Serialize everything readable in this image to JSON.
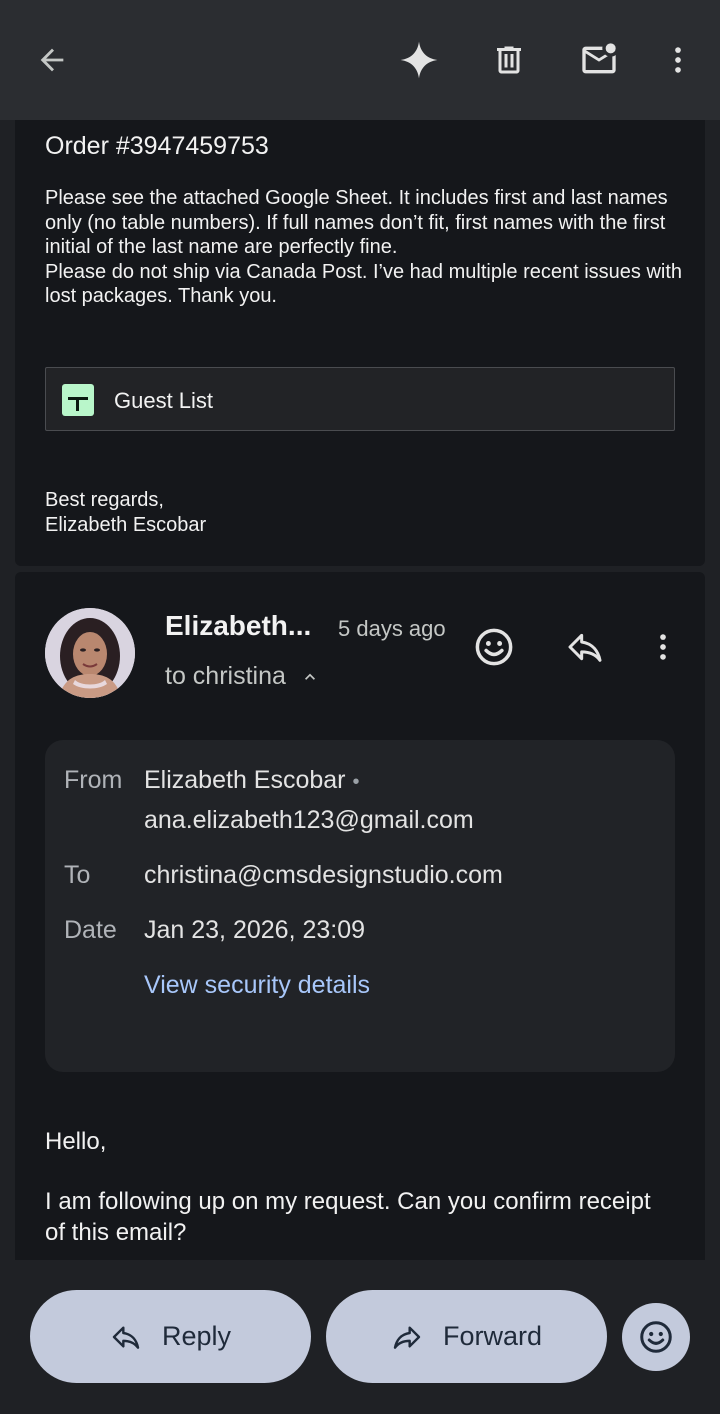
{
  "topbar": {
    "back_icon": "arrow-left-icon",
    "gemini_icon": "sparkle-icon",
    "delete_icon": "trash-icon",
    "mark_unread_icon": "mail-unread-icon",
    "more_icon": "more-vertical-icon"
  },
  "previous_message": {
    "order": "Order #3947459753",
    "body_lines": [
      "Please see the attached Google Sheet. It includes first and last names only (no table numbers). If full names don’t fit, first names with the first initial of the last name are perfectly fine.",
      "Please do not ship via Canada Post. I’ve had multiple recent issues with lost packages. Thank you."
    ],
    "attachment": {
      "label": "Guest List",
      "icon": "google-sheets-icon"
    },
    "closing": "Best regards,",
    "signature": "Elizabeth Escobar"
  },
  "message": {
    "sender_short": "Elizabeth...",
    "time_ago": "5 days ago",
    "to_line": "to christina",
    "details": {
      "from_label": "From",
      "from_name": "Elizabeth Escobar",
      "from_dot": "•",
      "from_email": "ana.elizabeth123@gmail.com",
      "to_label": "To",
      "to_value": "christina@cmsdesignstudio.com",
      "date_label": "Date",
      "date_value": "Jan 23, 2026, 23:09",
      "security_link": "View security details"
    },
    "greeting": "Hello,",
    "body": "I am following up on my request. Can you confirm receipt of this email?"
  },
  "actions": {
    "reply_label": "Reply",
    "forward_label": "Forward"
  },
  "colors": {
    "background": "#1f2125",
    "card": "#15171b",
    "details_card": "#212327",
    "link": "#a8c7fa",
    "pill": "#c3cadc",
    "sheet_icon": "#b9f6ca"
  }
}
